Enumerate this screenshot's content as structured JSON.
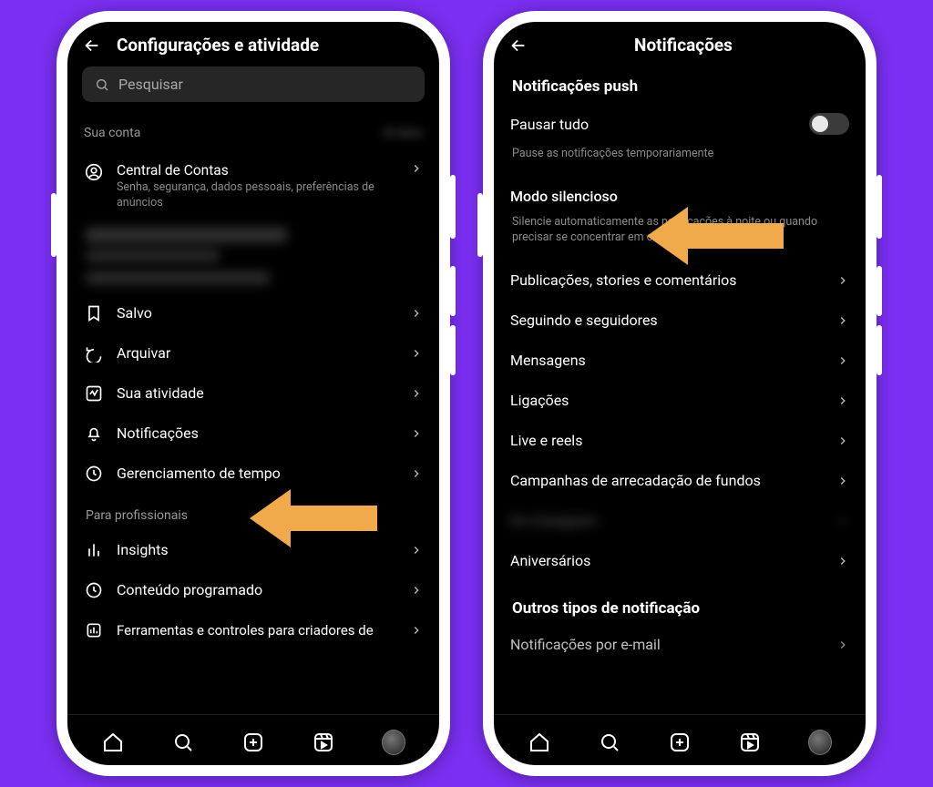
{
  "left": {
    "header_title": "Configurações e atividade",
    "search_placeholder": "Pesquisar",
    "account_section": "Sua conta",
    "accounts_center": {
      "title": "Central de Contas",
      "subtitle": "Senha, segurança, dados pessoais, preferências de anúncios"
    },
    "items": [
      {
        "icon": "bookmark",
        "label": "Salvo"
      },
      {
        "icon": "archive",
        "label": "Arquivar"
      },
      {
        "icon": "activity",
        "label": "Sua atividade"
      },
      {
        "icon": "bell",
        "label": "Notificações"
      },
      {
        "icon": "clock",
        "label": "Gerenciamento de tempo"
      }
    ],
    "pro_section": "Para profissionais",
    "pro_items": [
      {
        "icon": "insights",
        "label": "Insights"
      },
      {
        "icon": "clock",
        "label": "Conteúdo programado"
      },
      {
        "icon": "creator",
        "label": "Ferramentas e controles para criadores de"
      }
    ]
  },
  "right": {
    "header_title": "Notificações",
    "push_section": "Notificações push",
    "pause_all": "Pausar tudo",
    "pause_desc": "Pause as notificações temporariamente",
    "quiet_mode": "Modo silencioso",
    "quiet_desc": "Silencie automaticamente as notificações à noite ou quando precisar se concentrar em outra atividade.",
    "items": [
      "Publicações, stories e comentários",
      "Seguindo e seguidores",
      "Mensagens",
      "Ligações",
      "Live e reels",
      "Campanhas de arrecadação de fundos"
    ],
    "blurred_item": "Do Instagram",
    "last_item": "Aniversários",
    "other_section": "Outros tipos de notificação",
    "cutoff_item": "Notificações por e-mail"
  },
  "colors": {
    "arrow": "#f0a94b",
    "bg": "#7b2ff2"
  }
}
